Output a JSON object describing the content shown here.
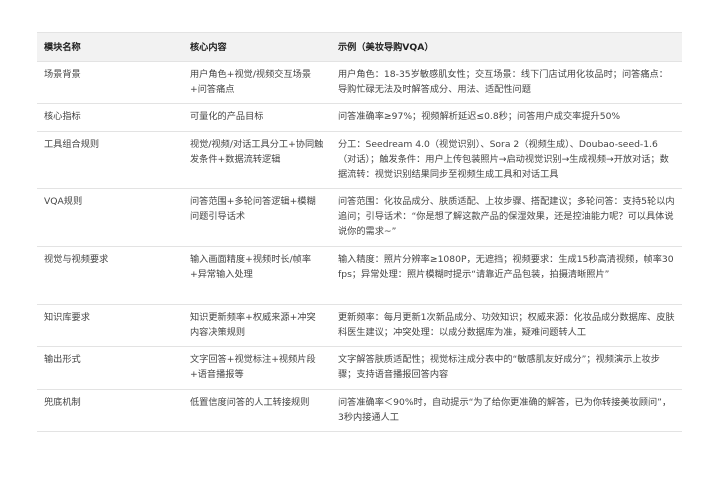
{
  "table": {
    "headers": [
      "模块名称",
      "核心内容",
      "示例（美妆导购VQA）"
    ],
    "rows": [
      {
        "module": "场景背景",
        "core": "用户角色+视觉/视频交互场景+问答痛点",
        "example": "用户角色：18-35岁敏感肌女性；交互场景：线下门店试用化妆品时；问答痛点：导购忙碌无法及时解答成分、用法、适配性问题"
      },
      {
        "module": "核心指标",
        "core": "可量化的产品目标",
        "example": "问答准确率≥97%；视频解析延迟≤0.8秒；问答用户成交率提升50%"
      },
      {
        "module": "工具组合规则",
        "core": "视觉/视频/对话工具分工+协同触发条件+数据流转逻辑",
        "example": "分工：Seedream 4.0（视觉识别）、Sora 2（视频生成）、Doubao-seed-1.6（对话）；触发条件：用户上传包装照片→启动视觉识别→生成视频→开放对话；数据流转：视觉识别结果同步至视频生成工具和对话工具"
      },
      {
        "module": "VQA规则",
        "core": "问答范围+多轮问答逻辑+模糊问题引导话术",
        "example": "问答范围：化妆品成分、肤质适配、上妆步骤、搭配建议；多轮问答：支持5轮以内追问；引导话术：“你是想了解这款产品的保湿效果，还是控油能力呢？可以具体说说你的需求~”"
      },
      {
        "module": "视觉与视频要求",
        "core": "输入画面精度+视频时长/帧率+异常输入处理",
        "example": "输入精度：照片分辨率≥1080P，无遮挡；视频要求：生成15秒高清视频，帧率30fps；异常处理：照片模糊时提示“请靠近产品包装，拍摄清晰照片”"
      },
      {
        "module": "知识库要求",
        "core": "知识更新频率+权威来源+冲突内容决策规则",
        "example": "更新频率：每月更新1次新品成分、功效知识；权威来源：化妆品成分数据库、皮肤科医生建议；冲突处理：以成分数据库为准，疑难问题转人工"
      },
      {
        "module": "输出形式",
        "core": "文字回答+视觉标注+视频片段+语音播报等",
        "example": "文字解答肤质适配性；视觉标注成分表中的“敏感肌友好成分”；视频演示上妆步骤；支持语音播报回答内容"
      },
      {
        "module": "兜底机制",
        "core": "低置信度问答的人工转接规则",
        "example": "问答准确率＜90%时，自动提示“为了给你更准确的解答，已为你转接美妆顾问”，3秒内接通人工"
      }
    ]
  }
}
